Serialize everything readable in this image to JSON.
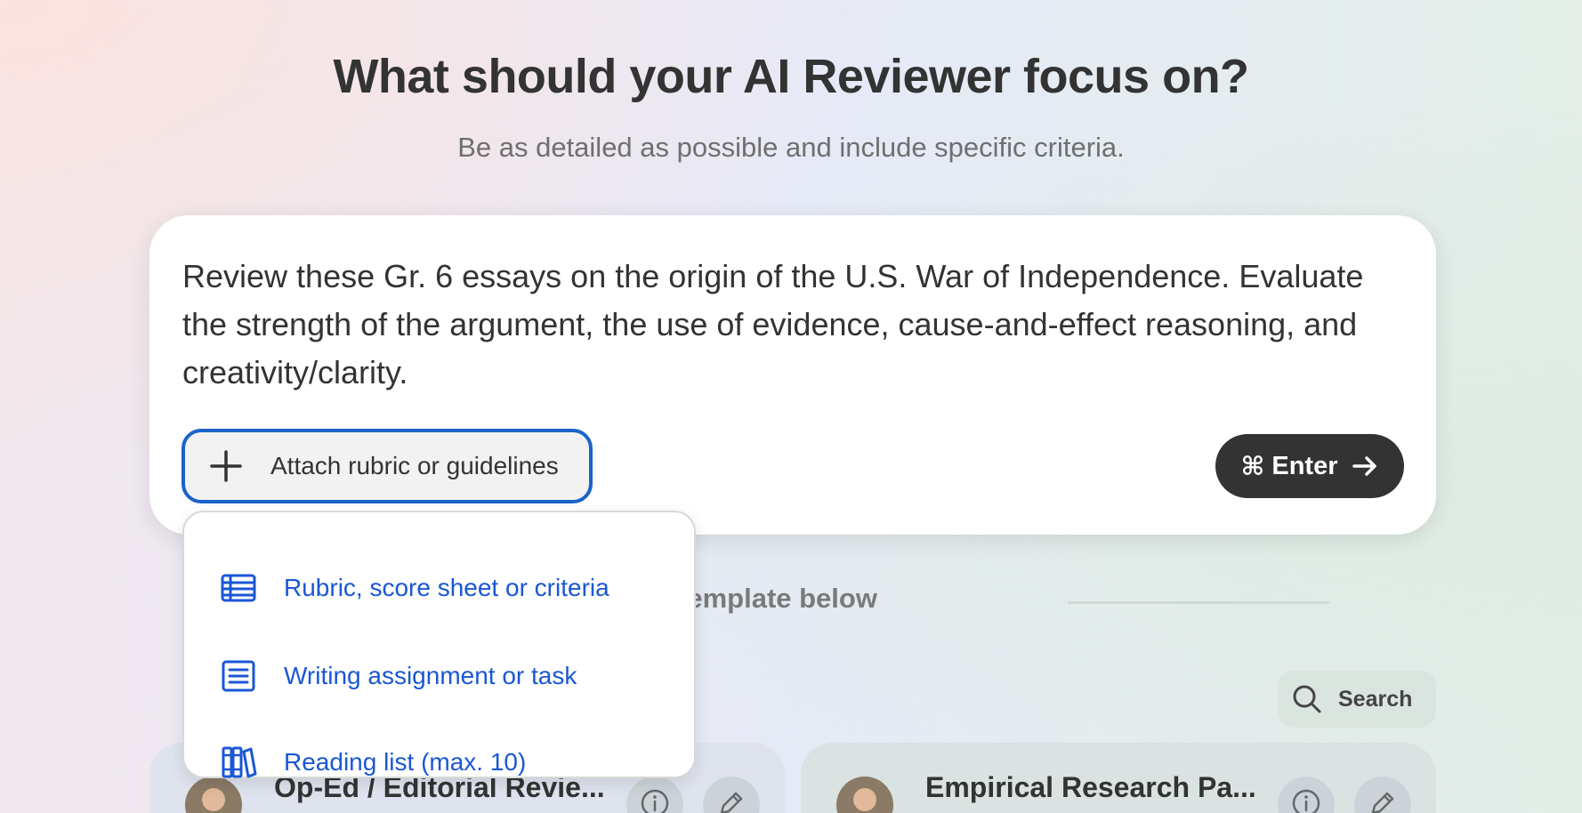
{
  "header": {
    "title": "What should your AI Reviewer focus on?",
    "subtitle": "Be as detailed as possible and include specific criteria."
  },
  "prompt": {
    "text": "Review these Gr. 6 essays on the origin of the U.S. War of Independence. Evaluate the strength of the argument, the use of evidence, cause-and-effect reasoning, and creativity/clarity.",
    "attach_label": "Attach rubric or guidelines",
    "enter_cmd": "⌘",
    "enter_label": "Enter"
  },
  "dropdown": {
    "items": [
      {
        "label": "Rubric, score sheet or criteria",
        "icon": "table-icon"
      },
      {
        "label": "Writing assignment or task",
        "icon": "document-lines-icon"
      },
      {
        "label": "Reading list (max. 10)",
        "icon": "books-icon"
      }
    ]
  },
  "templates": {
    "divider_text": "lect template below",
    "search_label": "Search",
    "cards": [
      {
        "name": "Op-Ed / Editorial Revie..."
      },
      {
        "name": "Empirical Research Pa..."
      }
    ]
  },
  "colors": {
    "accent": "#1a57d4",
    "focus_border": "#1a63c9",
    "dark_button": "#333333"
  }
}
